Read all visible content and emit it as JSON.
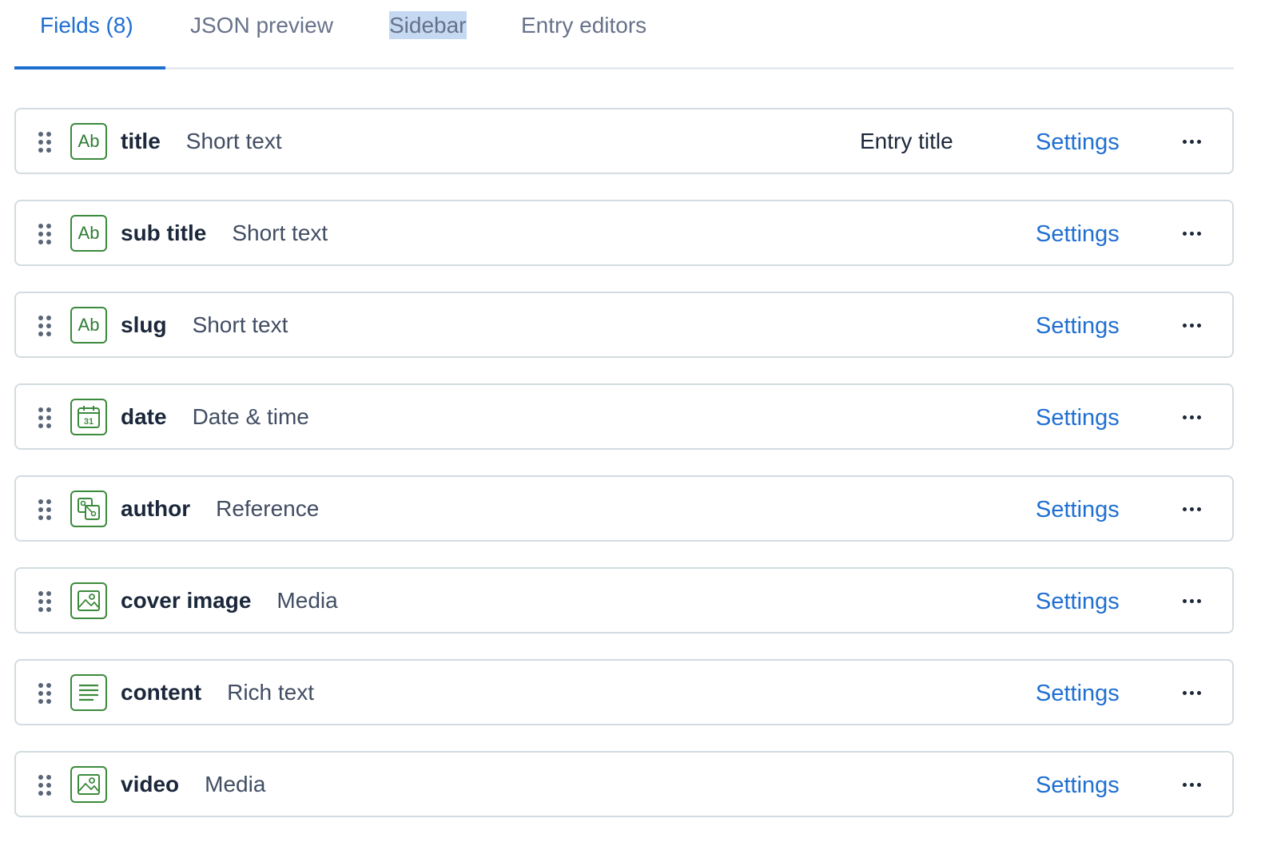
{
  "tabs": [
    {
      "label": "Fields (8)",
      "active": true
    },
    {
      "label": "JSON preview",
      "active": false
    },
    {
      "label": "Sidebar",
      "active": false,
      "highlighted": true
    },
    {
      "label": "Entry editors",
      "active": false
    }
  ],
  "colors": {
    "accent": "#1f6fd1",
    "icon_green": "#3c8a3c",
    "border": "#d3dce0"
  },
  "settings_label": "Settings",
  "fields": [
    {
      "name": "title",
      "type": "Short text",
      "icon": "short-text-icon",
      "badge": "Entry title"
    },
    {
      "name": "sub title",
      "type": "Short text",
      "icon": "short-text-icon"
    },
    {
      "name": "slug",
      "type": "Short text",
      "icon": "short-text-icon"
    },
    {
      "name": "date",
      "type": "Date & time",
      "icon": "calendar-icon",
      "icon_text": "31"
    },
    {
      "name": "author",
      "type": "Reference",
      "icon": "reference-icon"
    },
    {
      "name": "cover image",
      "type": "Media",
      "icon": "media-icon"
    },
    {
      "name": "content",
      "type": "Rich text",
      "icon": "rich-text-icon"
    },
    {
      "name": "video",
      "type": "Media",
      "icon": "media-icon"
    }
  ],
  "short_text_icon_label": "Ab"
}
